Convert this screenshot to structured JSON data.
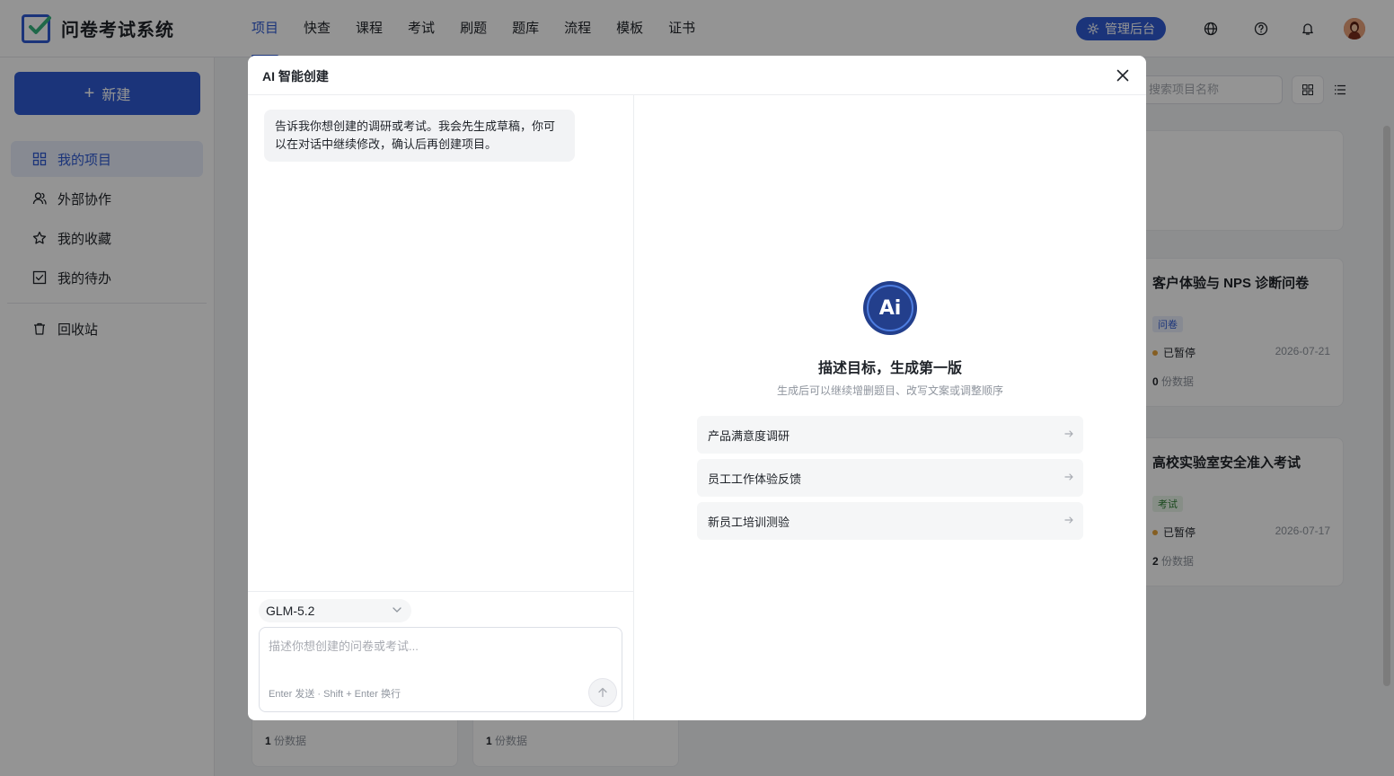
{
  "app": {
    "title": "问卷考试系统"
  },
  "nav": {
    "items": [
      "项目",
      "快查",
      "课程",
      "考试",
      "刷题",
      "题库",
      "流程",
      "模板",
      "证书"
    ],
    "active_index": 0
  },
  "header": {
    "admin_label": "管理后台",
    "icons": [
      "globe-icon",
      "help-icon",
      "bell-icon"
    ]
  },
  "sidebar": {
    "new_label": "新建",
    "items": [
      {
        "label": "我的项目",
        "icon": "grid-icon",
        "active": true
      },
      {
        "label": "外部协作",
        "icon": "people-icon"
      },
      {
        "label": "我的收藏",
        "icon": "star-icon"
      },
      {
        "label": "我的待办",
        "icon": "checkbox-icon"
      },
      {
        "label": "回收站",
        "icon": "trash-icon"
      }
    ]
  },
  "main": {
    "search_placeholder": "搜索项目名称",
    "cards": [
      {
        "title": "客户体验与 NPS 诊断问卷",
        "tag": "问卷",
        "status": "已暂停",
        "date": "2026-07-21",
        "count": "0",
        "count_label": "份数据"
      },
      {
        "title": "高校实验室安全准入考试",
        "tag": "考试",
        "status": "已暂停",
        "date": "2026-07-17",
        "count": "2",
        "count_label": "份数据"
      }
    ],
    "bottom_cards": [
      {
        "count": "1",
        "count_label": "份数据"
      },
      {
        "count": "1",
        "count_label": "份数据"
      }
    ]
  },
  "modal": {
    "title": "AI 智能创建",
    "assistant_message": "告诉我你想创建的调研或考试。我会先生成草稿，你可以在对话中继续修改，确认后再创建项目。",
    "model": "GLM-5.2",
    "input_placeholder": "描述你想创建的问卷或考试...",
    "input_hint": "Enter 发送 · Shift + Enter 换行",
    "ai_logo_text": "Ai",
    "headline": "描述目标，生成第一版",
    "subline": "生成后可以继续增删题目、改写文案或调整顺序",
    "suggestions": [
      "产品满意度调研",
      "员工工作体验反馈",
      "新员工培训测验"
    ]
  },
  "colors": {
    "accent": "#2f5bd3",
    "paused": "#e6a23c",
    "tag_survey": "#2f5bd3",
    "tag_exam": "#2e7d32"
  }
}
